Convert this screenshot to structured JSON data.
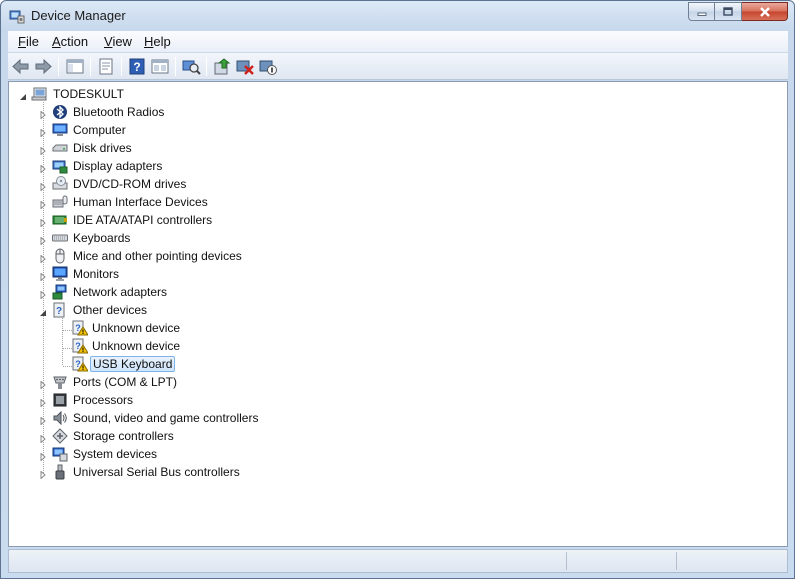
{
  "window": {
    "title": "Device Manager",
    "icon": "device-manager-icon"
  },
  "menubar": {
    "items": [
      {
        "label": "File",
        "accel": "F",
        "rest": "ile"
      },
      {
        "label": "Action",
        "accel": "A",
        "rest": "ction"
      },
      {
        "label": "View",
        "accel": "V",
        "rest": "iew"
      },
      {
        "label": "Help",
        "accel": "H",
        "rest": "elp"
      }
    ]
  },
  "toolbar": {
    "buttons": [
      "back-arrow-icon",
      "forward-arrow-icon",
      "show-hide-console-tree-icon",
      "properties-icon",
      "help-icon",
      "view-icon",
      "scan-hardware-changes-icon",
      "update-driver-icon",
      "uninstall-icon",
      "disable-device-icon"
    ]
  },
  "tree": {
    "root": "TODESKULT",
    "categories": [
      {
        "label": "Bluetooth Radios",
        "icon": "bluetooth-icon"
      },
      {
        "label": "Computer",
        "icon": "computer-icon"
      },
      {
        "label": "Disk drives",
        "icon": "disk-drive-icon"
      },
      {
        "label": "Display adapters",
        "icon": "display-adapter-icon"
      },
      {
        "label": "DVD/CD-ROM drives",
        "icon": "dvd-drive-icon"
      },
      {
        "label": "Human Interface Devices",
        "icon": "hid-icon"
      },
      {
        "label": "IDE ATA/ATAPI controllers",
        "icon": "ide-controller-icon"
      },
      {
        "label": "Keyboards",
        "icon": "keyboard-icon"
      },
      {
        "label": "Mice and other pointing devices",
        "icon": "mouse-icon"
      },
      {
        "label": "Monitors",
        "icon": "monitor-icon"
      },
      {
        "label": "Network adapters",
        "icon": "network-adapter-icon"
      },
      {
        "label": "Other devices",
        "icon": "other-devices-icon",
        "expanded": true,
        "children": [
          {
            "label": "Unknown device",
            "icon": "warning-device-icon"
          },
          {
            "label": "Unknown device",
            "icon": "warning-device-icon"
          },
          {
            "label": "USB Keyboard",
            "icon": "warning-device-icon",
            "selected": true
          }
        ]
      },
      {
        "label": "Ports (COM & LPT)",
        "icon": "port-icon"
      },
      {
        "label": "Processors",
        "icon": "processor-icon"
      },
      {
        "label": "Sound, video and game controllers",
        "icon": "sound-icon"
      },
      {
        "label": "Storage controllers",
        "icon": "storage-controller-icon"
      },
      {
        "label": "System devices",
        "icon": "system-devices-icon"
      },
      {
        "label": "Universal Serial Bus controllers",
        "icon": "usb-icon"
      }
    ]
  },
  "colors": {
    "selection_border": "#7eb4ea",
    "selection_fill": "#dcebfc",
    "warning": "#f2c200"
  }
}
